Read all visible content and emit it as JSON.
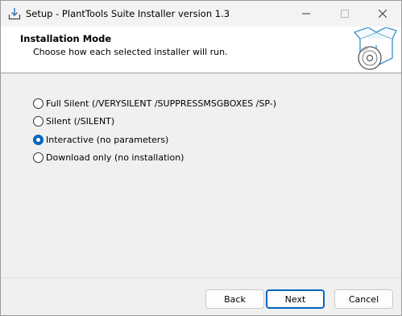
{
  "window": {
    "title": "Setup - PlantTools Suite Installer version 1.3",
    "app_icon": "download-tray-icon"
  },
  "header": {
    "title": "Installation Mode",
    "subtitle": "Choose how each selected installer will run.",
    "image": "package-disc-icon"
  },
  "options": [
    {
      "label": "Full Silent  (/VERYSILENT /SUPPRESSMSGBOXES /SP-)",
      "checked": false
    },
    {
      "label": "Silent  (/SILENT)",
      "checked": false
    },
    {
      "label": "Interactive  (no parameters)",
      "checked": true
    },
    {
      "label": "Download only  (no installation)",
      "checked": false
    }
  ],
  "buttons": {
    "back": "Back",
    "next": "Next",
    "cancel": "Cancel"
  },
  "colors": {
    "accent": "#0067c0",
    "window_bg": "#f0f0f0",
    "header_bg": "#ffffff"
  }
}
